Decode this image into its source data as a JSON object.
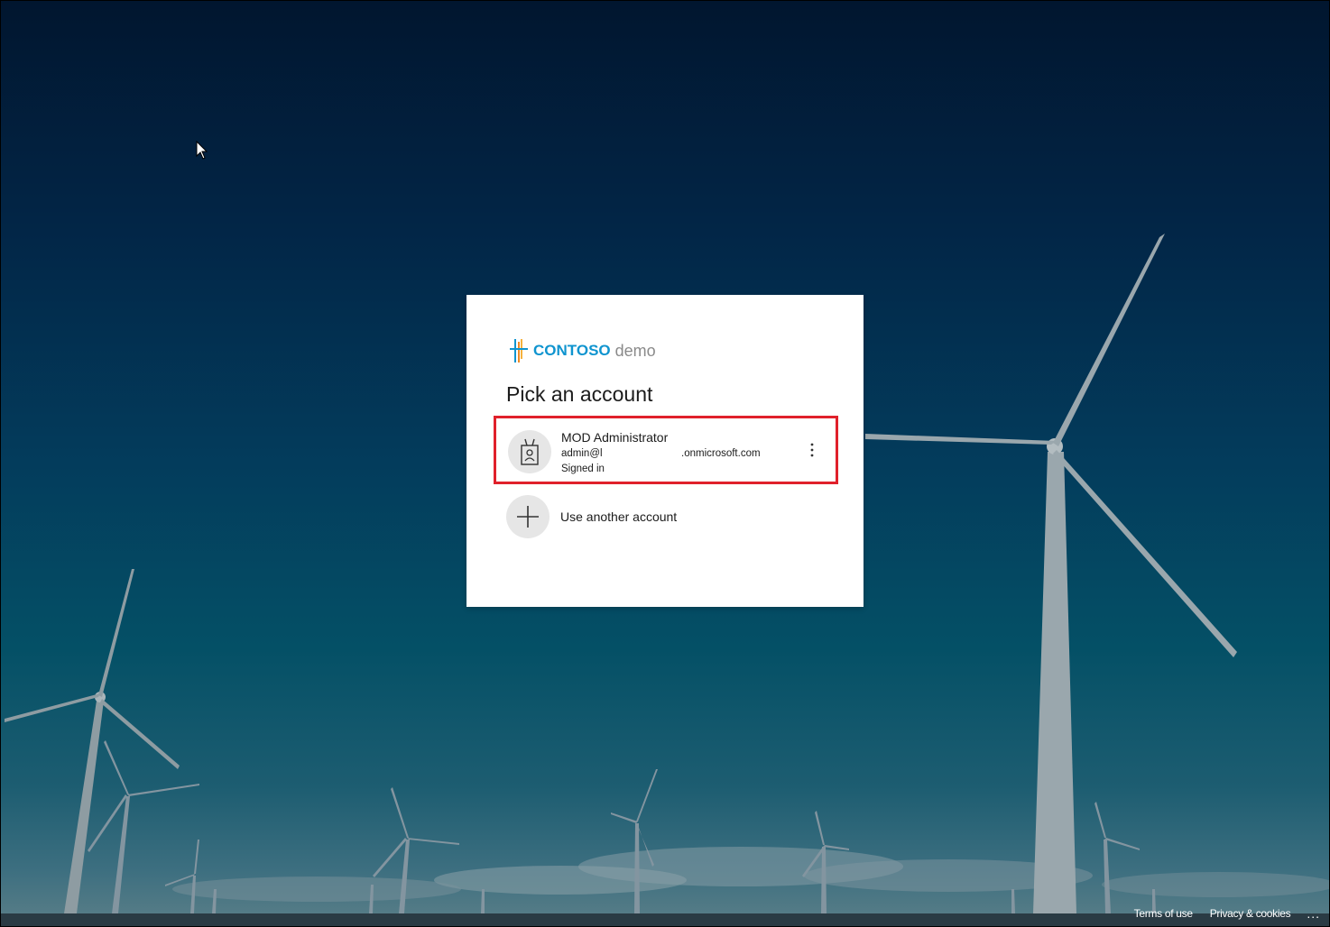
{
  "background": {
    "description_icon": "wind-turbines-background",
    "sky_top": "#01162f",
    "sky_bottom": "#5b7f88"
  },
  "brand": {
    "name": "CONTOSO",
    "suffix": "demo",
    "color": "#0f94cf"
  },
  "dialog": {
    "title": "Pick an account",
    "accounts": [
      {
        "name": "MOD Administrator",
        "email_prefix": "admin@l",
        "email_suffix": ".onmicrosoft.com",
        "status": "Signed in",
        "icon": "badge-icon",
        "more_icon": "more-options-icon"
      }
    ],
    "highlight_color": "#e0212b",
    "other_option": {
      "label": "Use another account",
      "icon": "plus-icon"
    }
  },
  "footer": {
    "terms": "Terms of use",
    "privacy": "Privacy & cookies",
    "more": "..."
  }
}
